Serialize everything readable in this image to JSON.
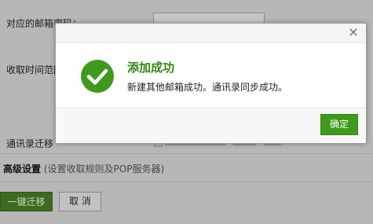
{
  "background": {
    "row1_label": "对应的邮箱密码：",
    "row2_label": "收取时间范围",
    "row3_label": "通讯录迁移",
    "advanced_title": "高级设置",
    "advanced_hint": "(设置收取规则及POP服务器)",
    "migrate_button": "一键迁移",
    "cancel_button": "取 消"
  },
  "dialog": {
    "close_glyph": "×",
    "title": "添加成功",
    "message": "新建其他邮箱成功。通讯录同步成功。",
    "confirm_button": "确定"
  },
  "colors": {
    "success_green": "#2f8a12",
    "button_green": "#3f9a1c"
  },
  "icons": {
    "success": "check-circle-icon",
    "close": "close-icon"
  }
}
